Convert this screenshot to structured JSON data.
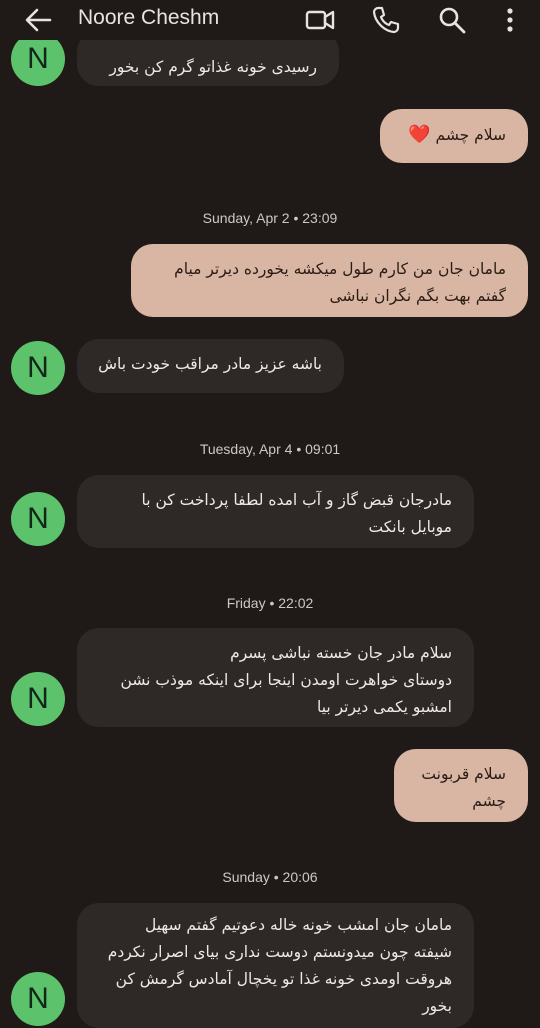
{
  "header": {
    "contact_name": "Noore Cheshm",
    "icons": [
      "back-arrow-icon",
      "video-call-icon",
      "phone-icon",
      "search-icon",
      "more-vert-icon"
    ]
  },
  "avatar_letter": "N",
  "messages": {
    "m0": {
      "lines": [
        "رسیدی خونه غذاتو گرم کن بخور"
      ]
    },
    "m1": {
      "text": "سلام چشم",
      "emoji": "❤️"
    },
    "d1": "Sunday, Apr 2 • 23:09",
    "m2": {
      "lines": [
        "مامان جان من کارم طول میکشه یخورده دیرتر میام",
        "گفتم بهت بگم نگران نباشی"
      ]
    },
    "m3": {
      "lines": [
        "باشه عزیز مادر مراقب خودت باش"
      ]
    },
    "d2": "Tuesday, Apr 4 • 09:01",
    "m4": {
      "lines": [
        "مادرجان قبض گاز و آب امده لطفا پرداخت کن با",
        "موبایل بانکت"
      ]
    },
    "d3": "Friday • 22:02",
    "m5": {
      "lines": [
        "سلام مادر جان خسته نباشی پسرم",
        "دوستای خواهرت اومدن اینجا برای اینکه موذب نشن",
        "امشبو یکمی دیرتر بیا"
      ]
    },
    "m6": {
      "lines": [
        "سلام قربونت",
        "چشم"
      ]
    },
    "d4": "Sunday • 20:06",
    "m7": {
      "lines": [
        "مامان جان امشب خونه خاله دعوتیم گفتم سهیل",
        "شیفته چون میدونستم دوست نداری بیای اصرار نکردم",
        "هروقت اومدی خونه غذا تو یخچال آمادس گرمش کن",
        "بخور"
      ]
    }
  },
  "colors": {
    "background": "#1f1a18",
    "incoming_bubble": "#2e2926",
    "outgoing_bubble": "#d9b6a3",
    "avatar": "#5cc36c"
  }
}
